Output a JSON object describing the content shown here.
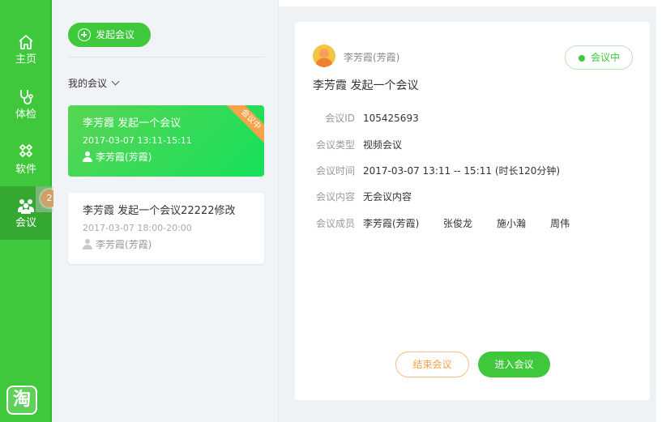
{
  "nav": {
    "items": [
      {
        "label": "主页",
        "icon": "home-icon"
      },
      {
        "label": "体检",
        "icon": "stethoscope-icon"
      },
      {
        "label": "软件",
        "icon": "apps-icon"
      },
      {
        "label": "会议",
        "icon": "meeting-icon"
      }
    ],
    "badge": "2",
    "logo_text": "淘"
  },
  "list": {
    "start_button": "发起会议",
    "filter_label": "我的会议",
    "meetings": [
      {
        "title": "李芳霞 发起一个会议",
        "time": "2017-03-07 13:11-15:11",
        "owner": "李芳霞(芳霞)",
        "ribbon": "会议中"
      },
      {
        "title": "李芳霞 发起一个会议22222修改",
        "time": "2017-03-07 18:00-20:00",
        "owner": "李芳霞(芳霞)"
      }
    ]
  },
  "detail": {
    "owner": "李芳霞(芳霞)",
    "status": "会议中",
    "title": "李芳霞 发起一个会议",
    "fields": {
      "id_label": "会议ID",
      "id_value": "105425693",
      "type_label": "会议类型",
      "type_value": "视频会议",
      "time_label": "会议时间",
      "time_value": "2017-03-07 13:11 -- 15:11 (时长120分钟)",
      "content_label": "会议内容",
      "content_value": "无会议内容",
      "members_label": "会议成员"
    },
    "members": [
      "李芳霞(芳霞)",
      "张俊龙",
      "施小瀚",
      "周伟"
    ],
    "end_button": "结束会议",
    "join_button": "进入会议"
  },
  "colors": {
    "accent": "#3fc83b",
    "warning": "#f9a24c"
  }
}
